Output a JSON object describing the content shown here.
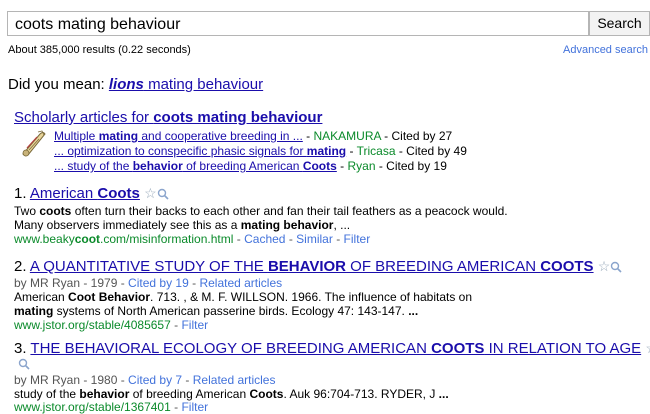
{
  "search": {
    "query": "coots mating behaviour",
    "button_label": "Search",
    "stats": "About 385,000 results (0.22 seconds)",
    "advanced_link": "Advanced search"
  },
  "did_you_mean": {
    "prefix": "Did you mean: ",
    "suggestion_bold": "lions",
    "suggestion_rest": " mating behaviour"
  },
  "scholarly": {
    "title_prefix": "Scholarly articles for ",
    "title_bold": "coots mating behaviour",
    "items": [
      {
        "link_a": "Multiple ",
        "link_b": "mating",
        "link_c": " and cooperative breeding in ...",
        "author": "NAKAMURA",
        "cited": "Cited by 27"
      },
      {
        "link_a": "... optimization to conspecific phasic signals for ",
        "link_b": "mating",
        "link_c": "",
        "author": "Tricasa",
        "cited": "Cited by 49"
      },
      {
        "link_a": "... study of the ",
        "link_b": "behavior",
        "link_c": " of breeding American ",
        "link_d": "Coots",
        "author": "Ryan",
        "cited": "Cited by 19"
      }
    ]
  },
  "results": [
    {
      "num": "1.",
      "title_a": "American ",
      "title_b": "Coots",
      "snippet1_a": "Two ",
      "snippet1_b": "coots",
      "snippet1_c": " often turn their backs to each other and fan their tail feathers as a peacock would.",
      "snippet2_a": "Many observers immediately see this as a ",
      "snippet2_b": "mating behavior",
      "snippet2_c": ", ...",
      "url_a": "www.beaky",
      "url_b": "coot",
      "url_c": ".com/misinformation.html",
      "cached": "Cached",
      "similar": "Similar",
      "filter": "Filter"
    },
    {
      "num": "2.",
      "title_a": "A QUANTITATIVE STUDY OF THE ",
      "title_b": "BEHAVIOR",
      "title_c": " OF BREEDING AMERICAN ",
      "title_d": "COOTS",
      "meta_a": "by MR Ryan - 1979 - ",
      "cited": "Cited by 19",
      "related": "Related articles",
      "snippet1_a": "American ",
      "snippet1_b": "Coot Behavior",
      "snippet1_c": ". 713. , & M. F. WILLSON. 1966. The influence of habitats on",
      "snippet2_a": "mating",
      "snippet2_b": " systems of North American passerine birds. Ecology 47: 143-147. ",
      "snippet2_c": "...",
      "url": "www.jstor.org/stable/4085657",
      "filter": "Filter"
    },
    {
      "num": "3.",
      "title_a": "THE BEHAVIORAL ECOLOGY OF BREEDING AMERICAN ",
      "title_b": "COOTS",
      "title_c": " IN RELATION TO AGE",
      "meta_a": "by MR Ryan - 1980 - ",
      "cited": "Cited by 7",
      "related": "Related articles",
      "snippet1_a": "study of the ",
      "snippet1_b": "behavior",
      "snippet1_c": " of breeding American ",
      "snippet1_d": "Coots",
      "snippet1_e": ". Auk 96:704-713. RYDER, J ",
      "snippet1_f": "...",
      "url": "www.jstor.org/stable/1367401",
      "filter": "Filter"
    }
  ]
}
